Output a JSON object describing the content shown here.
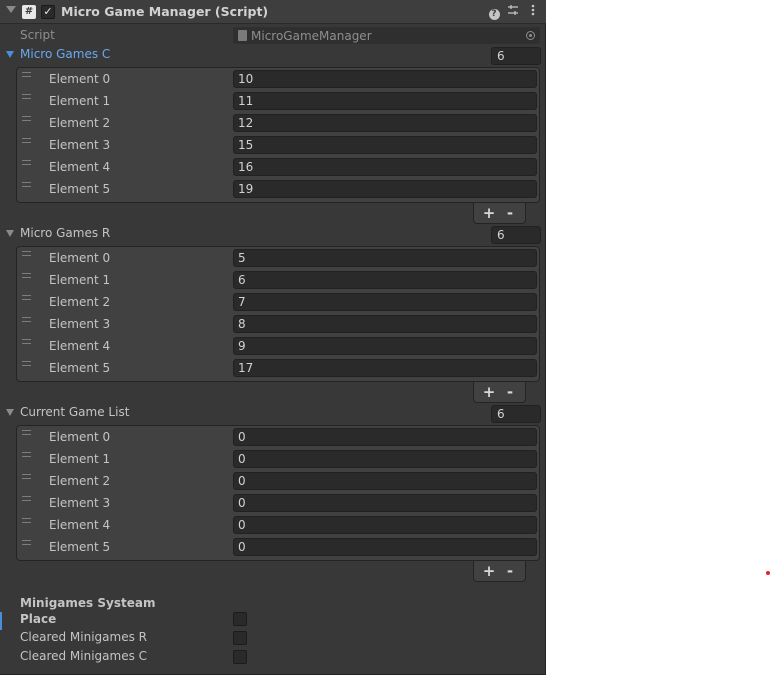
{
  "header": {
    "title": "Micro Game Manager (Script)",
    "script_icon": "#",
    "enabled_check": "✓",
    "icons": [
      "help-icon",
      "presets-icon",
      "more-icon"
    ]
  },
  "script": {
    "label": "Script",
    "value": "MicroGameManager"
  },
  "lists": [
    {
      "title": "Micro Games C",
      "expanded": true,
      "size": "6",
      "elements": [
        {
          "label": "Element 0",
          "value": "10"
        },
        {
          "label": "Element 1",
          "value": "11"
        },
        {
          "label": "Element 2",
          "value": "12"
        },
        {
          "label": "Element 3",
          "value": "15"
        },
        {
          "label": "Element 4",
          "value": "16"
        },
        {
          "label": "Element 5",
          "value": "19"
        }
      ]
    },
    {
      "title": "Micro Games R",
      "expanded": true,
      "size": "6",
      "elements": [
        {
          "label": "Element 0",
          "value": "5"
        },
        {
          "label": "Element 1",
          "value": "6"
        },
        {
          "label": "Element 2",
          "value": "7"
        },
        {
          "label": "Element 3",
          "value": "8"
        },
        {
          "label": "Element 4",
          "value": "9"
        },
        {
          "label": "Element 5",
          "value": "17"
        }
      ]
    },
    {
      "title": "Current Game List",
      "expanded": true,
      "size": "6",
      "elements": [
        {
          "label": "Element 0",
          "value": "0"
        },
        {
          "label": "Element 1",
          "value": "0"
        },
        {
          "label": "Element 2",
          "value": "0"
        },
        {
          "label": "Element 3",
          "value": "0"
        },
        {
          "label": "Element 4",
          "value": "0"
        },
        {
          "label": "Element 5",
          "value": "0"
        }
      ]
    }
  ],
  "list_buttons": {
    "add": "+",
    "remove": "-"
  },
  "toggles": {
    "section_title": "Minigames Systeam Place",
    "items": [
      {
        "label": "",
        "checked": false
      },
      {
        "label": "Cleared Minigames R",
        "checked": false
      },
      {
        "label": "Cleared Minigames C",
        "checked": false
      }
    ]
  },
  "colors": {
    "panel": "#383838",
    "field": "#2a2a2a",
    "accent": "#4c8ddb",
    "text": "#c4c4c4"
  }
}
